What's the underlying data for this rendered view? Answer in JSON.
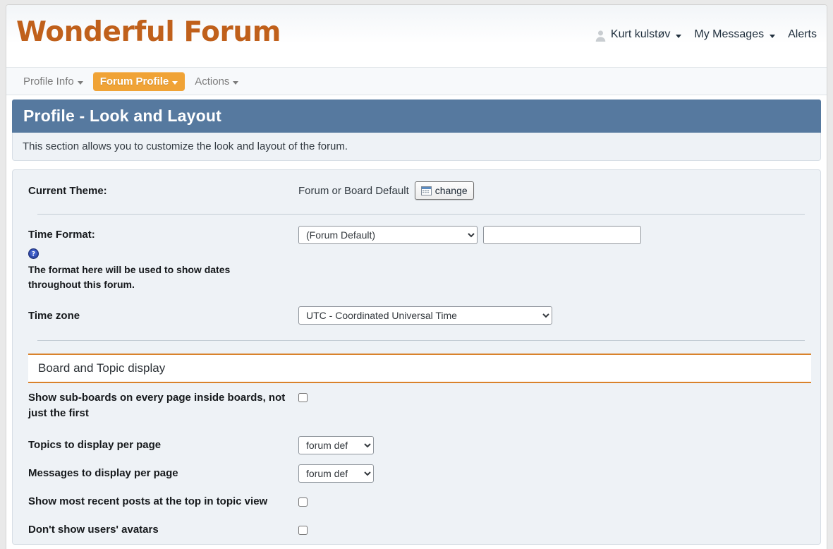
{
  "header": {
    "site_title": "Wonderful Forum",
    "user_menu": {
      "avatar_icon": "avatar-icon",
      "username": "Kurt kulstøv"
    },
    "messages_label": "My Messages",
    "alerts_label": "Alerts"
  },
  "nav": {
    "tabs": [
      {
        "label": "Profile Info",
        "has_caret": true,
        "active": false
      },
      {
        "label": "Forum Profile",
        "has_caret": true,
        "active": true
      },
      {
        "label": "Actions",
        "has_caret": true,
        "active": false
      }
    ]
  },
  "section": {
    "title": "Profile - Look and Layout",
    "description": "This section allows you to customize the look and layout of the forum."
  },
  "form": {
    "theme": {
      "label": "Current Theme:",
      "value": "Forum or Board Default",
      "change_button": "change",
      "change_icon": "grid-icon"
    },
    "time_format": {
      "label": "Time Format:",
      "select_value": "(Forum Default)",
      "select_options": [
        "(Forum Default)"
      ],
      "input_value": "",
      "input_placeholder": "",
      "help_icon": "help-circle-icon",
      "hint": "The format here will be used to show dates throughout this forum."
    },
    "time_zone": {
      "label": "Time zone",
      "select_value": "UTC - Coordinated Universal Time",
      "select_options": [
        "UTC - Coordinated Universal Time"
      ]
    },
    "board_topic_section": {
      "title": "Board and Topic display",
      "options": [
        {
          "label": "Show sub-boards on every page inside boards, not just the first",
          "type": "checkbox",
          "checked": false
        },
        {
          "label": "Topics to display per page",
          "type": "select",
          "value": "forum default",
          "options": [
            "forum default"
          ]
        },
        {
          "label": "Messages to display per page",
          "type": "select",
          "value": "forum default",
          "options": [
            "forum default"
          ]
        },
        {
          "label": "Show most recent posts at the top in topic view",
          "type": "checkbox",
          "checked": false
        },
        {
          "label": "Don't show users' avatars",
          "type": "checkbox",
          "checked": false
        }
      ]
    }
  },
  "colors": {
    "brand_title": "#c0601b",
    "active_tab": "#f0a336",
    "section_bar": "#56799f",
    "panel_bg": "#eef2f6",
    "sub_header_rule": "#d9822b"
  }
}
